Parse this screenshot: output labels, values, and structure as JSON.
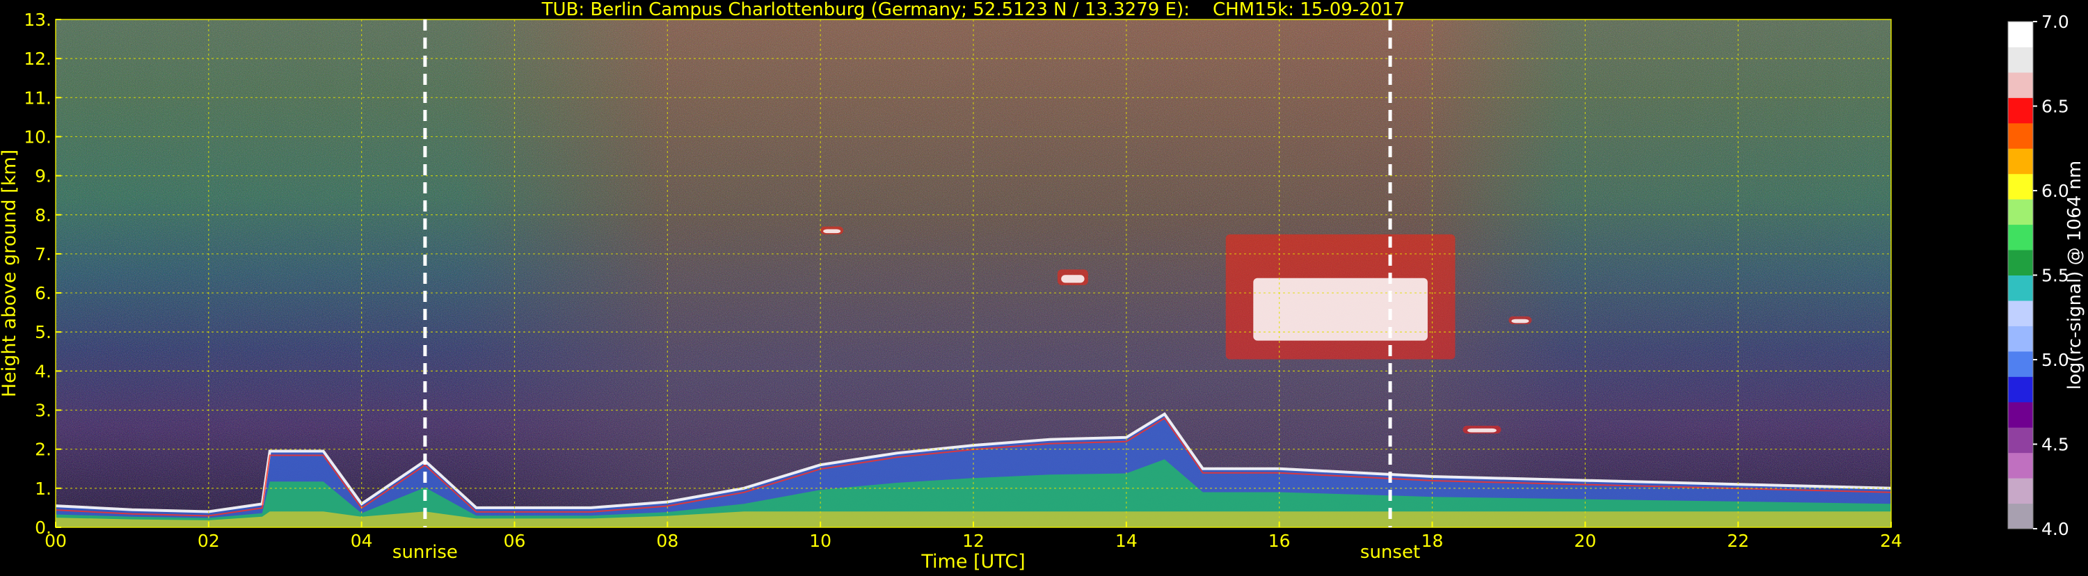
{
  "chart_data": {
    "type": "heatmap",
    "title": "TUB: Berlin Campus Charlottenburg (Germany; 52.5123 N / 13.3279 E):    CHM15k: 15-09-2017",
    "xlabel": "Time [UTC]",
    "ylabel": "Height above ground [km]",
    "xlim": [
      0,
      24
    ],
    "ylim": [
      0,
      13
    ],
    "xticks": [
      0,
      2,
      4,
      6,
      8,
      10,
      12,
      14,
      16,
      18,
      20,
      22,
      24
    ],
    "xtick_labels": [
      "00",
      "02",
      "04",
      "06",
      "08",
      "10",
      "12",
      "14",
      "16",
      "18",
      "20",
      "22",
      "24"
    ],
    "yticks": [
      0,
      1,
      2,
      3,
      4,
      5,
      6,
      7,
      8,
      9,
      10,
      11,
      12,
      13
    ],
    "ytick_labels": [
      "0.",
      "1.",
      "2.",
      "3.",
      "4.",
      "5.",
      "6.",
      "7.",
      "8.",
      "9.",
      "10.",
      "11.",
      "12.",
      "13."
    ],
    "grid": true,
    "annotations": [
      {
        "label": "sunrise",
        "x": 4.83
      },
      {
        "label": "sunset",
        "x": 17.45
      }
    ],
    "colorbar": {
      "label": "log(rc-signal) @ 1064 nm",
      "range": [
        4.0,
        7.0
      ],
      "ticks": [
        4.0,
        4.5,
        5.0,
        5.5,
        6.0,
        6.5,
        7.0
      ],
      "tick_labels": [
        "4.0",
        "4.5",
        "5.0",
        "5.5",
        "6.0",
        "6.5",
        "7.0"
      ]
    },
    "features": {
      "boundary_layer_top_km": [
        [
          0,
          0.55
        ],
        [
          1,
          0.45
        ],
        [
          2,
          0.4
        ],
        [
          2.7,
          0.6
        ],
        [
          2.8,
          1.95
        ],
        [
          3.5,
          1.95
        ],
        [
          4,
          0.6
        ],
        [
          4.83,
          1.7
        ],
        [
          5.5,
          0.5
        ],
        [
          7,
          0.5
        ],
        [
          8,
          0.65
        ],
        [
          9,
          1.0
        ],
        [
          10,
          1.6
        ],
        [
          11,
          1.9
        ],
        [
          12,
          2.1
        ],
        [
          13,
          2.25
        ],
        [
          14,
          2.3
        ],
        [
          14.5,
          2.9
        ],
        [
          15,
          1.5
        ],
        [
          16,
          1.5
        ],
        [
          18,
          1.3
        ],
        [
          20,
          1.2
        ],
        [
          22,
          1.1
        ],
        [
          24,
          1.0
        ]
      ],
      "cloud_layers": [
        {
          "start": 15.3,
          "end": 18.3,
          "base_km": 4.3,
          "top_km": 7.5
        },
        {
          "start": 13.1,
          "end": 13.5,
          "base_km": 6.2,
          "top_km": 6.6
        },
        {
          "start": 18.4,
          "end": 18.9,
          "base_km": 2.4,
          "top_km": 2.6
        },
        {
          "start": 10.0,
          "end": 10.3,
          "base_km": 7.5,
          "top_km": 7.7
        },
        {
          "start": 19.0,
          "end": 19.3,
          "base_km": 5.2,
          "top_km": 5.4
        }
      ]
    }
  },
  "colors": {
    "axis_text": "#ffff00",
    "grid": "#e0e000",
    "background": "#000000",
    "marker_line": "#ffffff",
    "colorbar_stops": [
      "#a8a0b0",
      "#c8a8c8",
      "#c070c0",
      "#9040a0",
      "#700090",
      "#2020e0",
      "#5080f0",
      "#9ab8ff",
      "#c0d0ff",
      "#30c0c0",
      "#20a040",
      "#40e060",
      "#a0f070",
      "#ffff20",
      "#ffb000",
      "#ff6000",
      "#ff1010",
      "#f0c0c0",
      "#e8e8e8",
      "#ffffff"
    ]
  }
}
